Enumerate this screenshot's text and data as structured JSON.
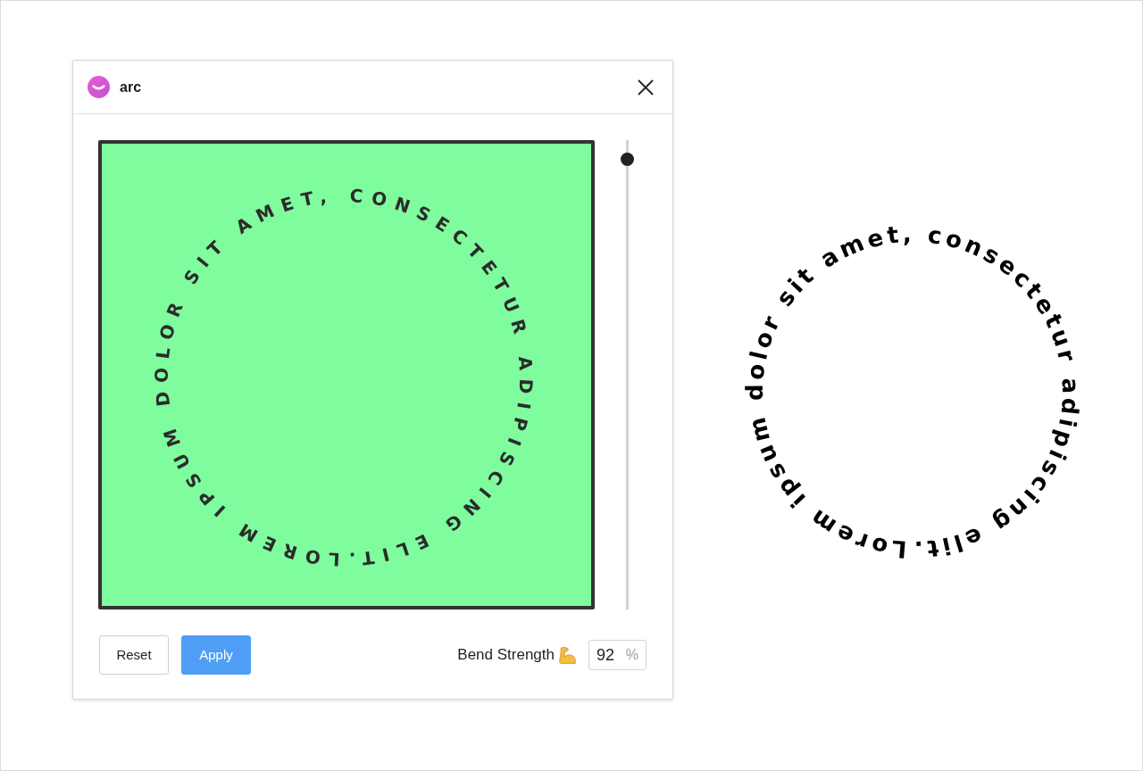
{
  "window": {
    "title": "arc"
  },
  "preview": {
    "text": "LOREM IPSUM DOLOR SIT AMET, CONSECTETUR ADIPISCING ELIT."
  },
  "slider": {
    "level": 0.96
  },
  "buttons": [
    {
      "label": "Reset",
      "kind": "secondary"
    },
    {
      "label": "Apply",
      "kind": "primary"
    }
  ],
  "bend_strength": {
    "label": "Bend Strength",
    "value": "92",
    "unit": "%"
  },
  "result": {
    "text": "Lorem ipsum dolor sit amet, consectetur adipiscing elit."
  }
}
